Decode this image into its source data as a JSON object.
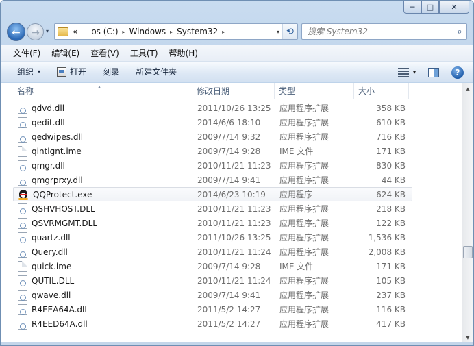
{
  "window": {
    "minimize_glyph": "─",
    "maximize_glyph": "□",
    "close_glyph": "✕"
  },
  "nav": {
    "back_glyph": "←",
    "forward_glyph": "→",
    "history_glyph": "▾"
  },
  "address": {
    "overflow": "«",
    "crumbs": [
      "os (C:)",
      "Windows",
      "System32"
    ],
    "separator": "▸",
    "dropdown_glyph": "▾",
    "refresh_glyph": "⟲"
  },
  "search": {
    "placeholder": "搜索 System32",
    "icon_glyph": "⌕"
  },
  "menu": [
    "文件(F)",
    "编辑(E)",
    "查看(V)",
    "工具(T)",
    "帮助(H)"
  ],
  "commands": {
    "organize": "组织",
    "open": "打开",
    "burn": "刻录",
    "new_folder": "新建文件夹",
    "dropdown_glyph": "▾",
    "help_glyph": "?"
  },
  "columns": {
    "name": "名称",
    "date": "修改日期",
    "type": "类型",
    "size": "大小",
    "sort_glyph": "▴"
  },
  "files": [
    {
      "name": "qdvd.dll",
      "date": "2011/10/26 13:25",
      "type": "应用程序扩展",
      "size": "358 KB",
      "icon": "dll-file-icon"
    },
    {
      "name": "qedit.dll",
      "date": "2014/6/6 18:10",
      "type": "应用程序扩展",
      "size": "610 KB",
      "icon": "dll-file-icon"
    },
    {
      "name": "qedwipes.dll",
      "date": "2009/7/14 9:32",
      "type": "应用程序扩展",
      "size": "716 KB",
      "icon": "dll-file-icon"
    },
    {
      "name": "qintlgnt.ime",
      "date": "2009/7/14 9:28",
      "type": "IME 文件",
      "size": "171 KB",
      "icon": "ime-file-icon"
    },
    {
      "name": "qmgr.dll",
      "date": "2010/11/21 11:23",
      "type": "应用程序扩展",
      "size": "830 KB",
      "icon": "dll-file-icon"
    },
    {
      "name": "qmgrprxy.dll",
      "date": "2009/7/14 9:41",
      "type": "应用程序扩展",
      "size": "44 KB",
      "icon": "dll-file-icon"
    },
    {
      "name": "QQProtect.exe",
      "date": "2014/6/23 10:19",
      "type": "应用程序",
      "size": "624 KB",
      "icon": "qq-penguin-icon"
    },
    {
      "name": "QSHVHOST.DLL",
      "date": "2010/11/21 11:23",
      "type": "应用程序扩展",
      "size": "218 KB",
      "icon": "dll-file-icon"
    },
    {
      "name": "QSVRMGMT.DLL",
      "date": "2010/11/21 11:23",
      "type": "应用程序扩展",
      "size": "122 KB",
      "icon": "dll-file-icon"
    },
    {
      "name": "quartz.dll",
      "date": "2011/10/26 13:25",
      "type": "应用程序扩展",
      "size": "1,536 KB",
      "icon": "dll-file-icon"
    },
    {
      "name": "Query.dll",
      "date": "2010/11/21 11:24",
      "type": "应用程序扩展",
      "size": "2,008 KB",
      "icon": "dll-file-icon"
    },
    {
      "name": "quick.ime",
      "date": "2009/7/14 9:28",
      "type": "IME 文件",
      "size": "171 KB",
      "icon": "ime-file-icon"
    },
    {
      "name": "QUTIL.DLL",
      "date": "2010/11/21 11:24",
      "type": "应用程序扩展",
      "size": "105 KB",
      "icon": "dll-file-icon"
    },
    {
      "name": "qwave.dll",
      "date": "2009/7/14 9:41",
      "type": "应用程序扩展",
      "size": "237 KB",
      "icon": "dll-file-icon"
    },
    {
      "name": "R4EEA64A.dll",
      "date": "2011/5/2 14:27",
      "type": "应用程序扩展",
      "size": "116 KB",
      "icon": "dll-file-icon"
    },
    {
      "name": "R4EED64A.dll",
      "date": "2011/5/2 14:27",
      "type": "应用程序扩展",
      "size": "417 KB",
      "icon": "dll-file-icon"
    }
  ],
  "hovered_row": 6,
  "scrollbar": {
    "up_glyph": "▲",
    "down_glyph": "▼"
  }
}
